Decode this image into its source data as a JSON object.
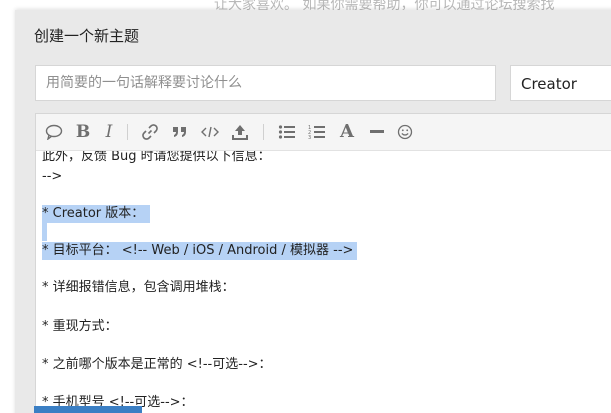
{
  "background": {
    "faded_text": "让大家喜欢。 如果你需要帮助，你可以通过论坛搜索找"
  },
  "composer": {
    "title": "创建一个新主题",
    "title_input": {
      "value": "",
      "placeholder": "用简要的一句话解释要讨论什么"
    },
    "category": {
      "selected": "Creator"
    },
    "toolbar": {
      "icons": [
        "quote-bubble-icon",
        "bold-icon",
        "italic-icon",
        "link-icon",
        "blockquote-icon",
        "code-icon",
        "upload-icon",
        "bullet-list-icon",
        "numbered-list-icon",
        "heading-icon",
        "horizontal-rule-icon",
        "emoji-icon"
      ],
      "bold_label": "B",
      "italic_label": "I",
      "heading_label": "A"
    },
    "editor_lines": [
      "此外，反馈 Bug 时请您提供以下信息：",
      "-->",
      "* Creator 版本：",
      "* 目标平台： <!-- Web / iOS / Android / 模拟器 -->",
      "* 详细报错信息，包含调用堆栈：",
      "* 重现方式：",
      "* 之前哪个版本是正常的 <!--可选-->：",
      "* 手机型号 <!--可选-->："
    ]
  },
  "colors": {
    "selection": "#b6d2f5",
    "panel": "#e9e9e9",
    "primary_button": "#3b7fc4"
  }
}
